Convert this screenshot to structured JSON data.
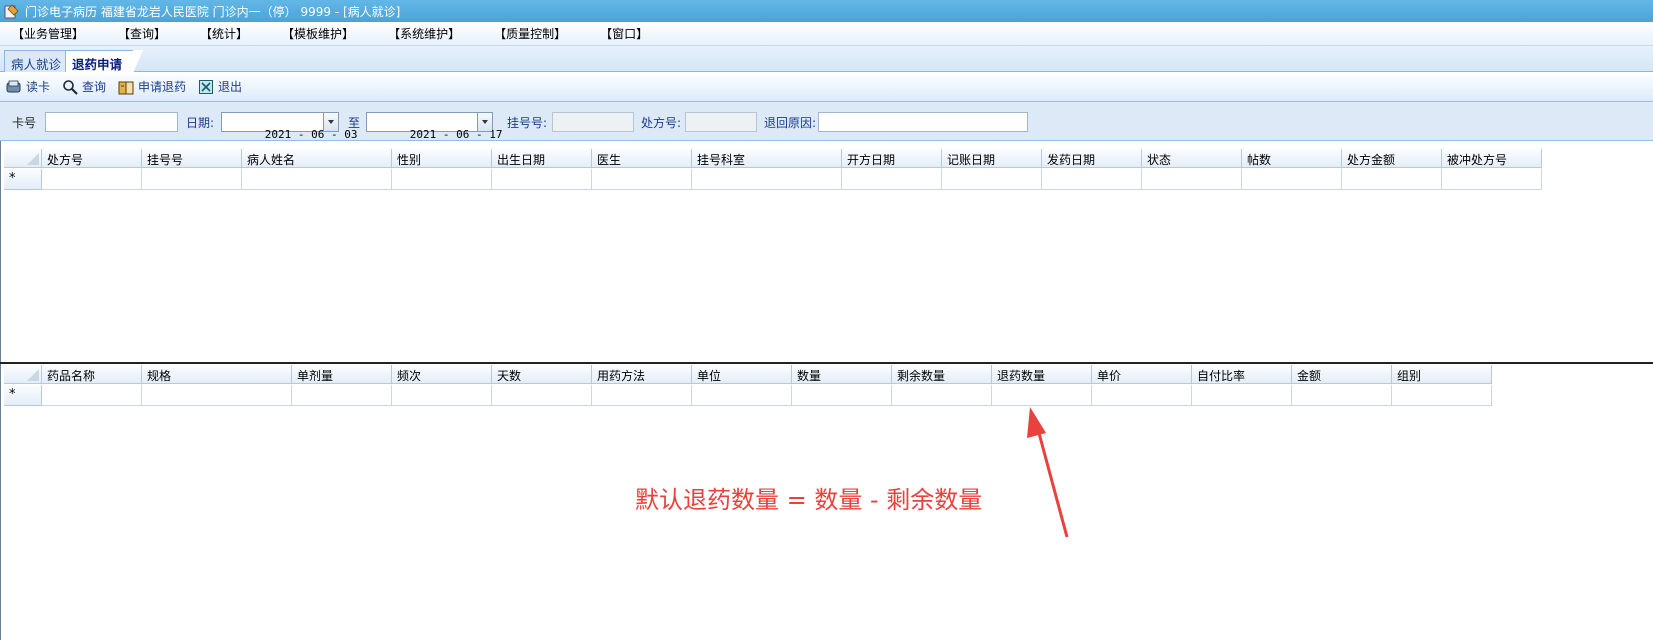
{
  "window": {
    "title": "门诊电子病历  福建省龙岩人民医院  门诊内一（停）   9999 - [病人就诊]"
  },
  "menu": {
    "items": [
      "【业务管理】",
      "【查询】",
      "【统计】",
      "【模板维护】",
      "【系统维护】",
      "【质量控制】",
      "【窗口】"
    ]
  },
  "tabs": {
    "items": [
      {
        "label": "病人就诊",
        "active": false
      },
      {
        "label": "退药申请",
        "active": true
      }
    ]
  },
  "toolbar": {
    "read_card": "读卡",
    "query": "查询",
    "apply_return": "申请退药",
    "exit": "退出"
  },
  "filters": {
    "card_label": "卡号",
    "card_value": "",
    "date_label": "日期:",
    "date_from": "2021 - 06 - 03",
    "to_label": "至",
    "date_to": "2021 - 06 - 17",
    "reg_no_label": "挂号号:",
    "reg_no_value": "",
    "rx_no_label": "处方号:",
    "rx_no_value": "",
    "return_reason_label": "退回原因:",
    "return_reason_value": ""
  },
  "prescription_grid": {
    "columns": [
      "处方号",
      "挂号号",
      "病人姓名",
      "性别",
      "出生日期",
      "医生",
      "挂号科室",
      "开方日期",
      "记账日期",
      "发药日期",
      "状态",
      "帖数",
      "处方金额",
      "被冲处方号"
    ],
    "new_row_marker": "*"
  },
  "drug_grid": {
    "columns": [
      "药品名称",
      "规格",
      "单剂量",
      "频次",
      "天数",
      "用药方法",
      "单位",
      "数量",
      "剩余数量",
      "退药数量",
      "单价",
      "自付比率",
      "金额",
      "组别"
    ],
    "new_row_marker": "*"
  },
  "annotation": {
    "text": "默认退药数量 = 数量 - 剩余数量",
    "color": "#e8413e"
  },
  "colors": {
    "title_bar": "#4aa3d8",
    "toolbar_text": "#1a3c8a"
  }
}
